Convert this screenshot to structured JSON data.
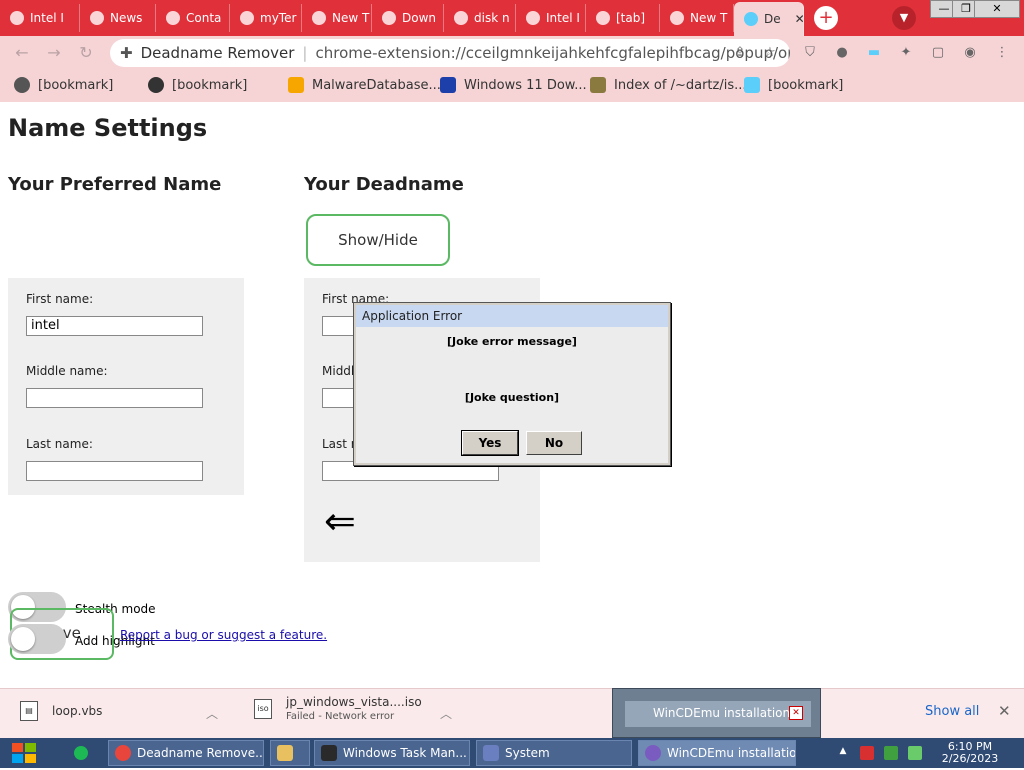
{
  "browser": {
    "tabs": [
      {
        "label": "Intel I"
      },
      {
        "label": "News"
      },
      {
        "label": "Conta"
      },
      {
        "label": "myTer"
      },
      {
        "label": "New T"
      },
      {
        "label": "Down"
      },
      {
        "label": "disk n"
      },
      {
        "label": "Intel I"
      },
      {
        "label": "[tab]"
      },
      {
        "label": "New T"
      },
      {
        "label": "De"
      }
    ],
    "new_tab": "+",
    "window_controls": [
      "—",
      "❐",
      "✕"
    ],
    "url": {
      "site": "Deadname Remover",
      "address": "chrome-extension://cceilgmnkeijahkehfcgfalepihfbcag/popup/opti..."
    },
    "bookmarks": [
      {
        "label": "[bookmark]",
        "icon": "user-icon",
        "color": "#555555"
      },
      {
        "label": "[bookmark]",
        "icon": "globe-icon",
        "color": "#333333"
      },
      {
        "label": "MalwareDatabase...",
        "icon": "ph-icon",
        "color": "#f7a600"
      },
      {
        "label": "Windows 11 Dow...",
        "icon": "x-icon",
        "color": "#1c3faa"
      },
      {
        "label": "Index of /~dartz/is...",
        "icon": "folder-icon",
        "color": "#8a7a40"
      },
      {
        "label": "[bookmark]",
        "icon": "trans-flag-icon",
        "color": "#5bcefa"
      }
    ]
  },
  "page": {
    "title": "Name Settings",
    "preferred_heading": "Your Preferred Name",
    "deadname_heading": "Your Deadname",
    "show_hide": "Show/Hide",
    "preferred": {
      "first_label": "First name:",
      "first_value": "intel",
      "middle_label": "Middle name:",
      "middle_value": "",
      "last_label": "Last name:",
      "last_value": ""
    },
    "deadname": {
      "first_label": "First name:",
      "middle_label": "Middle",
      "last_label": "Last n"
    },
    "arrow": "⇐",
    "stealth_label": "Stealth mode",
    "highlight_label": "Add highlight",
    "save": "Save",
    "bug_link": "Report a bug or suggest a feature."
  },
  "dialog": {
    "title": "Application Error",
    "message": "[Joke error message]",
    "question": "[Joke question]",
    "yes": "Yes",
    "no": "No"
  },
  "downloads": {
    "items": [
      {
        "name": "loop.vbs",
        "status": ""
      },
      {
        "name": "jp_windows_vista....iso",
        "status": "Failed - Network error"
      }
    ],
    "show_all": "Show all"
  },
  "wincdemu_popup": "WinCDEmu installation",
  "taskbar": {
    "items": [
      {
        "label": "Deadname Remove..."
      },
      {
        "label": ""
      },
      {
        "label": "Windows Task Man..."
      },
      {
        "label": "System"
      },
      {
        "label": "WinCDEmu installation"
      }
    ],
    "time": "6:10 PM",
    "date": "2/26/2023"
  },
  "colors": {
    "tabstrip": "#e0313b",
    "toolbar": "#f6d4d6",
    "accent_green": "#5bb863",
    "taskbar": "#2f4a73"
  }
}
